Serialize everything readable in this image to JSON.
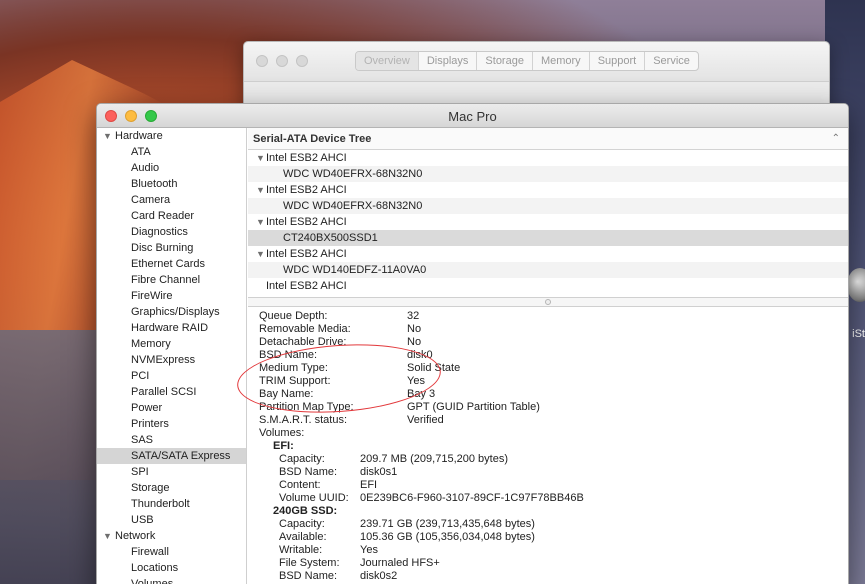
{
  "background_window": {
    "tabs": [
      "Overview",
      "Displays",
      "Storage",
      "Memory",
      "Support",
      "Service"
    ],
    "selected_tab": "Overview"
  },
  "window": {
    "title": "Mac Pro"
  },
  "sidebar": {
    "hardware_label": "Hardware",
    "hardware_items": [
      "ATA",
      "Audio",
      "Bluetooth",
      "Camera",
      "Card Reader",
      "Diagnostics",
      "Disc Burning",
      "Ethernet Cards",
      "Fibre Channel",
      "FireWire",
      "Graphics/Displays",
      "Hardware RAID",
      "Memory",
      "NVMExpress",
      "PCI",
      "Parallel SCSI",
      "Power",
      "Printers",
      "SAS",
      "SATA/SATA Express",
      "SPI",
      "Storage",
      "Thunderbolt",
      "USB"
    ],
    "selected_item": "SATA/SATA Express",
    "network_label": "Network",
    "network_items": [
      "Firewall",
      "Locations",
      "Volumes"
    ]
  },
  "tree": {
    "header": "Serial-ATA Device Tree",
    "rows": [
      {
        "text": "Intel ESB2 AHCI",
        "level": 0,
        "arrow": true
      },
      {
        "text": "WDC WD40EFRX-68N32N0",
        "level": 1
      },
      {
        "text": "Intel ESB2 AHCI",
        "level": 0,
        "arrow": true
      },
      {
        "text": "WDC WD40EFRX-68N32N0",
        "level": 1
      },
      {
        "text": "Intel ESB2 AHCI",
        "level": 0,
        "arrow": true
      },
      {
        "text": "CT240BX500SSD1",
        "level": 1,
        "selected": true
      },
      {
        "text": "Intel ESB2 AHCI",
        "level": 0,
        "arrow": true
      },
      {
        "text": "WDC WD140EDFZ-11A0VA0",
        "level": 1
      },
      {
        "text": "Intel ESB2 AHCI",
        "level": 0,
        "arrow": false
      }
    ]
  },
  "details": [
    {
      "k": "Queue Depth:",
      "v": "32",
      "level": 1
    },
    {
      "k": "Removable Media:",
      "v": "No",
      "level": 1
    },
    {
      "k": "Detachable Drive:",
      "v": "No",
      "level": 1
    },
    {
      "k": "BSD Name:",
      "v": "disk0",
      "level": 1
    },
    {
      "k": "Medium Type:",
      "v": "Solid State",
      "level": 1
    },
    {
      "k": "TRIM Support:",
      "v": "Yes",
      "level": 1
    },
    {
      "k": "Bay Name:",
      "v": "Bay 3",
      "level": 1
    },
    {
      "k": "Partition Map Type:",
      "v": "GPT (GUID Partition Table)",
      "level": 1
    },
    {
      "k": "S.M.A.R.T. status:",
      "v": "Verified",
      "level": 1
    },
    {
      "k": "Volumes:",
      "v": "",
      "level": 1
    },
    {
      "k": "EFI:",
      "v": "",
      "level": 2
    },
    {
      "k": "Capacity:",
      "v": "209.7 MB (209,715,200 bytes)",
      "level": 3
    },
    {
      "k": "BSD Name:",
      "v": "disk0s1",
      "level": 3
    },
    {
      "k": "Content:",
      "v": "EFI",
      "level": 3
    },
    {
      "k": "Volume UUID:",
      "v": "0E239BC6-F960-3107-89CF-1C97F78BB46B",
      "level": 3
    },
    {
      "k": "240GB SSD:",
      "v": "",
      "level": 2
    },
    {
      "k": "Capacity:",
      "v": "239.71 GB (239,713,435,648 bytes)",
      "level": 3
    },
    {
      "k": "Available:",
      "v": "105.36 GB (105,356,034,048 bytes)",
      "level": 3
    },
    {
      "k": "Writable:",
      "v": "Yes",
      "level": 3
    },
    {
      "k": "File System:",
      "v": "Journaled HFS+",
      "level": 3
    },
    {
      "k": "BSD Name:",
      "v": "disk0s2",
      "level": 3
    }
  ],
  "desktop": {
    "disk_label": "iSt"
  },
  "colors": {
    "annotation": "#e2383b",
    "selection": "#d5d5d5"
  }
}
